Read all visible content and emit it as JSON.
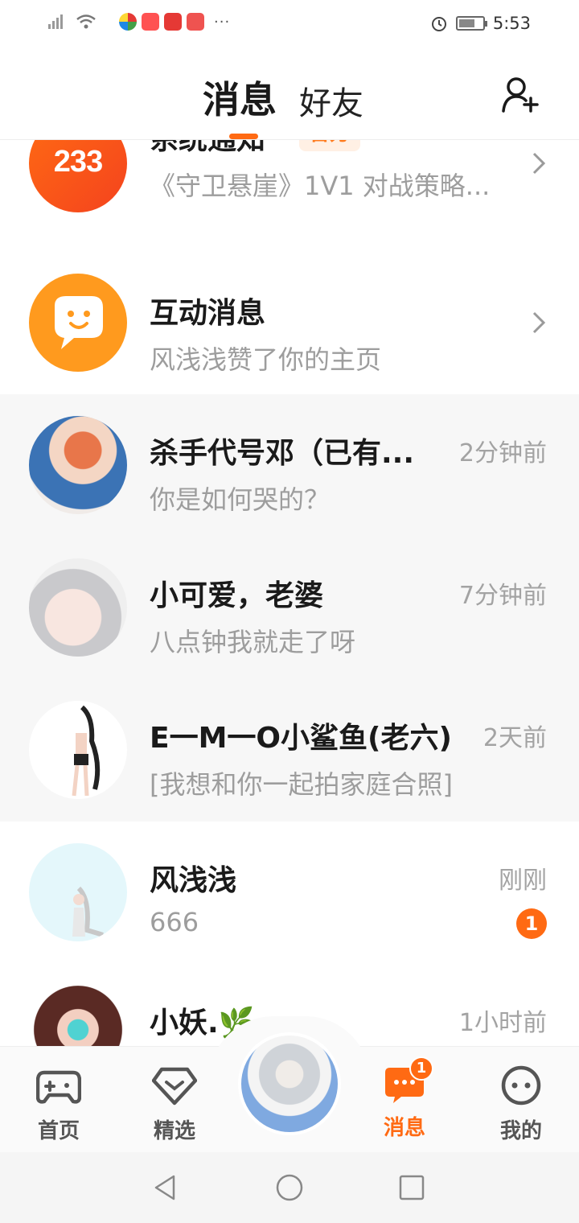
{
  "status_bar": {
    "time": "5:53",
    "icons": [
      "signal-icon",
      "wifi-icon",
      "app-icon",
      "app-icon",
      "app-icon",
      "app-icon",
      "alarm-icon",
      "battery-icon"
    ],
    "more": "···"
  },
  "header": {
    "tabs": [
      {
        "label": "消息",
        "active": true
      },
      {
        "label": "好友",
        "active": false
      }
    ],
    "add_friend_icon": "add-user-icon"
  },
  "conversations": [
    {
      "name": "系统通知",
      "badge": "官方",
      "preview": "《守卫悬崖》1V1 对战策略...",
      "icon": "chevron-right-icon",
      "avatar_text": "233"
    },
    {
      "name": "互动消息",
      "preview": "风浅浅赞了你的主页",
      "icon": "chevron-right-icon"
    },
    {
      "name": "杀手代号邓（已有...",
      "preview": "你是如何哭的？",
      "time": "2分钟前"
    },
    {
      "name": "小可爱，老婆",
      "preview": "八点钟我就走了呀",
      "time": "7分钟前"
    },
    {
      "name": "E一M一O小鲨鱼(老六)",
      "preview": "[我想和你一起拍家庭合照]",
      "time": "2天前"
    },
    {
      "name": "风浅浅",
      "preview": "666",
      "time": "刚刚",
      "unread": "1"
    },
    {
      "name": "小妖.🌿",
      "preview": "",
      "time": "1小时前"
    }
  ],
  "bottom_nav": {
    "items": [
      {
        "label": "首页",
        "icon": "gamepad-icon"
      },
      {
        "label": "精选",
        "icon": "heart-diamond-icon"
      },
      {
        "label": "消息",
        "icon": "chat-icon",
        "badge": "1",
        "active": true
      },
      {
        "label": "我的",
        "icon": "face-icon"
      }
    ]
  },
  "colors": {
    "accent": "#ff6a13",
    "text": "#1a1a1a",
    "muted": "#9d9d9d"
  }
}
